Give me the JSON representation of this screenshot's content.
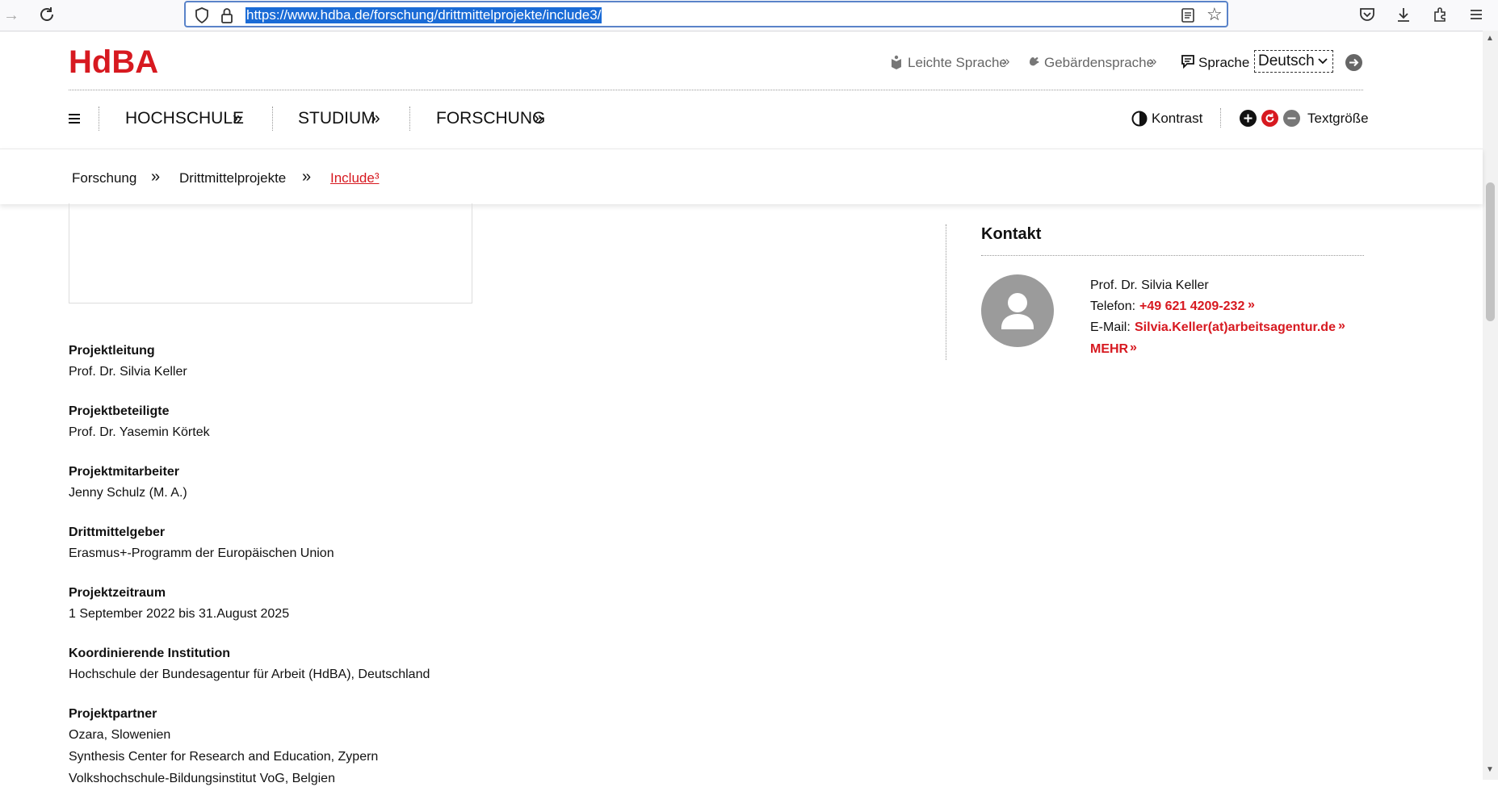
{
  "browser": {
    "url": "https://www.hdba.de/forschung/drittmittelprojekte/include3/"
  },
  "header": {
    "logo": "HdBA",
    "easy_language": "Leichte Sprache",
    "sign_language": "Gebärdensprache",
    "language_label": "Sprache",
    "language_value": "Deutsch",
    "nav": [
      "HOCHSCHULE",
      "STUDIUM",
      "FORSCHUNG"
    ],
    "contrast": "Kontrast",
    "textsize": "Textgröße"
  },
  "breadcrumb": [
    "Forschung",
    "Drittmittelprojekte",
    "Include³"
  ],
  "project": [
    {
      "label": "Projektleitung",
      "values": [
        "Prof. Dr. Silvia Keller"
      ]
    },
    {
      "label": "Projektbeteiligte",
      "values": [
        "Prof. Dr. Yasemin Körtek"
      ]
    },
    {
      "label": "Projektmitarbeiter",
      "values": [
        "Jenny Schulz (M. A.)"
      ]
    },
    {
      "label": "Drittmittelgeber",
      "values": [
        "Erasmus+-Programm der Europäischen Union"
      ]
    },
    {
      "label": "Projektzeitraum",
      "values": [
        "1 September 2022 bis 31.August 2025"
      ]
    },
    {
      "label": "Koordinierende Institution",
      "values": [
        "Hochschule der Bundesagentur für Arbeit (HdBA), Deutschland"
      ]
    },
    {
      "label": "Projektpartner",
      "values": [
        "Ozara, Slowenien",
        "Synthesis Center for Research and Education, Zypern",
        "Volkshochschule-Bildungsinstitut VoG, Belgien"
      ]
    }
  ],
  "contact": {
    "title": "Kontakt",
    "name": "Prof. Dr. Silvia Keller",
    "phone_label": "Telefon:",
    "phone": "+49 621 4209-232",
    "email_label": "E-Mail:",
    "email": "Silvia.Keller(at)arbeitsagentur.de",
    "more": "MEHR"
  },
  "colors": {
    "accent": "#d71920"
  }
}
